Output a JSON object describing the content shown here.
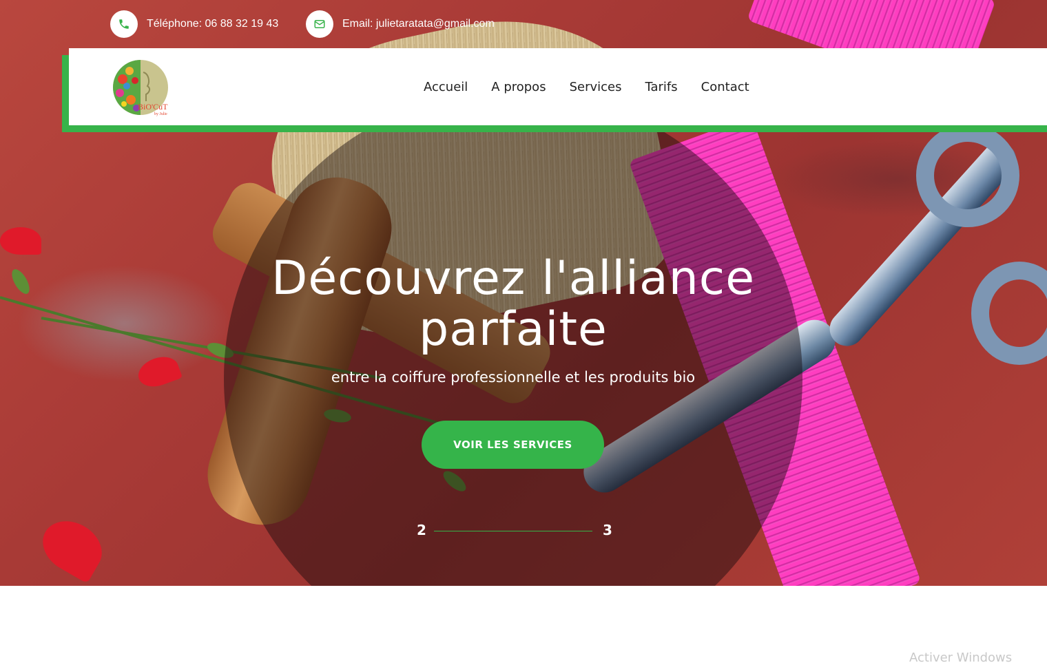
{
  "topbar": {
    "phone_text": "Téléphone: 06 88 32 19 43",
    "email_text": "Email: julietaratata@gmail.com"
  },
  "brand": {
    "logo_text": "BiO'CuT",
    "logo_subtext": "by Julie",
    "accent_color": "#37b34a"
  },
  "nav": {
    "items": [
      {
        "label": "Accueil"
      },
      {
        "label": "A propos"
      },
      {
        "label": "Services"
      },
      {
        "label": "Tarifs"
      },
      {
        "label": "Contact"
      }
    ]
  },
  "hero": {
    "title_line1": "Découvrez l'alliance",
    "title_line2": "parfaite",
    "subtitle": "entre la coiffure professionnelle et les produits bio",
    "cta_label": "VOIR LES SERVICES",
    "slide_prev": "2",
    "slide_next": "3"
  },
  "system": {
    "watermark": "Activer Windows"
  },
  "icons": {
    "phone": "phone-icon",
    "email": "envelope-icon"
  }
}
